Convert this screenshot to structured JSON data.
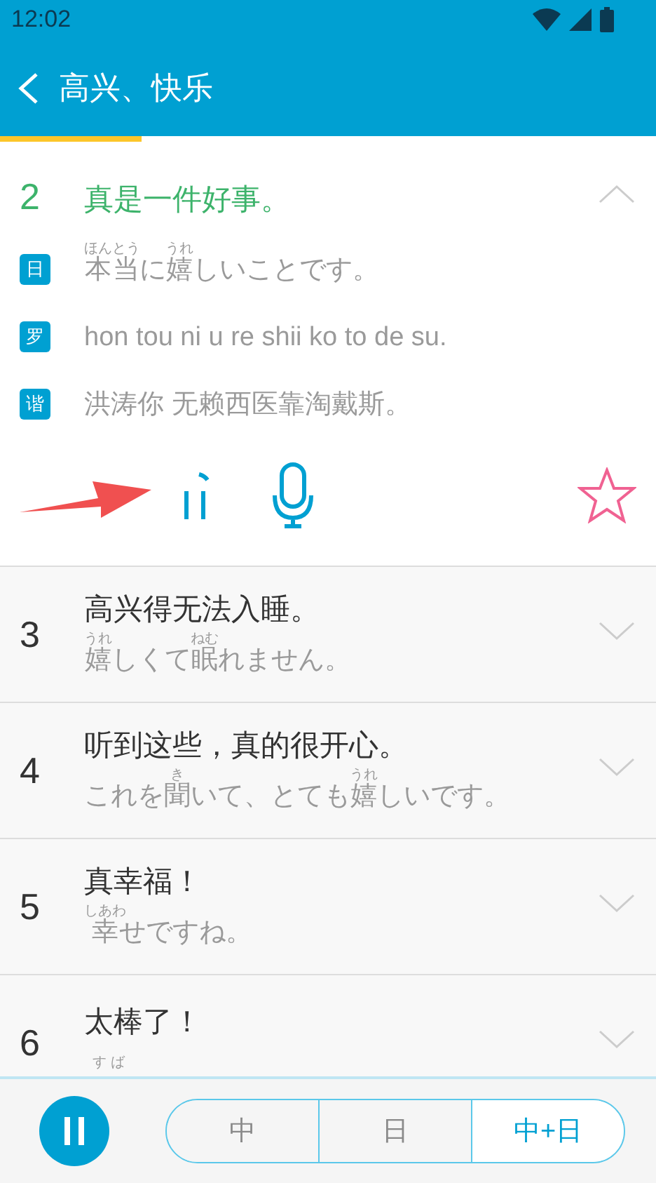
{
  "status_bar": {
    "time": "12:02"
  },
  "header": {
    "title": "高兴、快乐",
    "progress": {
      "level": 0.215
    }
  },
  "expanded": {
    "number": "2",
    "chinese": "真是一件好事。",
    "expanded": true,
    "favorite": false,
    "lines": [
      {
        "kind": "ruby",
        "badge": "日",
        "segments": [
          {
            "base": "本当",
            "ruby": "ほんとう"
          },
          {
            "base": "に"
          },
          {
            "base": "嬉",
            "ruby": "うれ"
          },
          {
            "base": "しいことです。"
          }
        ]
      },
      {
        "kind": "plain",
        "badge": "罗",
        "text": "hon tou ni u re shii ko to de su."
      },
      {
        "kind": "plain",
        "badge": "谐",
        "text": "洪涛你 无赖西医靠淘戴斯。"
      }
    ]
  },
  "rows": [
    {
      "number": "3",
      "chinese": "高兴得无法入睡。",
      "expanded": false,
      "segments": [
        {
          "base": "嬉",
          "ruby": "うれ"
        },
        {
          "base": "しくて"
        },
        {
          "base": "眠",
          "ruby": "ねむ"
        },
        {
          "base": "れません。"
        }
      ]
    },
    {
      "number": "4",
      "chinese": "听到这些，真的很开心。",
      "expanded": false,
      "segments": [
        {
          "base": "これを"
        },
        {
          "base": "聞",
          "ruby": "き"
        },
        {
          "base": "いて、とても"
        },
        {
          "base": "嬉",
          "ruby": "うれ"
        },
        {
          "base": "しいです。"
        }
      ]
    },
    {
      "number": "5",
      "chinese": "真幸福！",
      "expanded": false,
      "segments": [
        {
          "base": "幸",
          "ruby": "しあわ"
        },
        {
          "base": "せですね。"
        }
      ]
    },
    {
      "number": "6",
      "chinese": "太棒了！",
      "expanded": false,
      "segments": [
        {
          "ruby": "す ば"
        }
      ]
    }
  ],
  "footer": {
    "playing": true,
    "modes": [
      {
        "label": "中",
        "selected": false
      },
      {
        "label": "日",
        "selected": false
      },
      {
        "label": "中+日",
        "selected": true
      }
    ]
  }
}
